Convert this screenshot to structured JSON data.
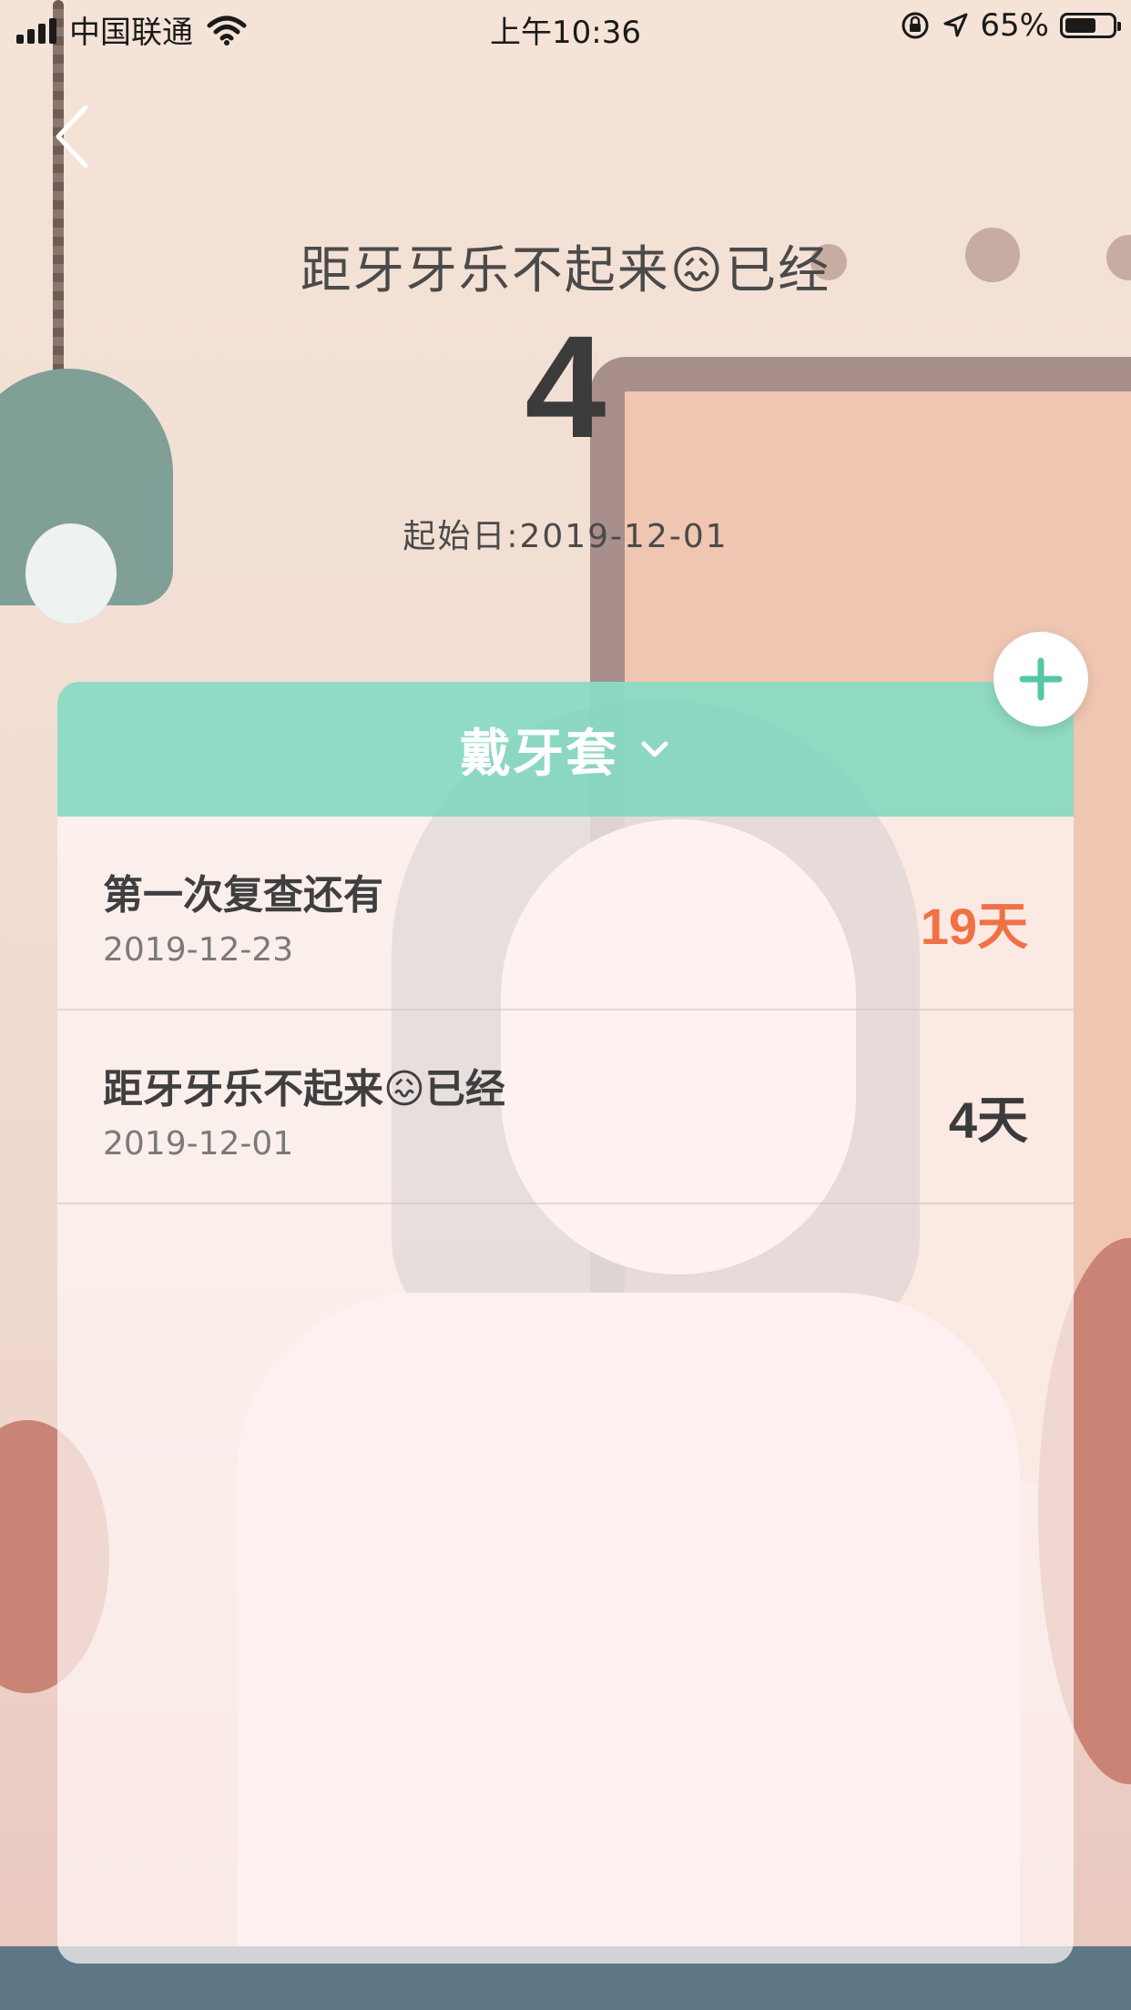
{
  "status_bar": {
    "carrier": "中国联通",
    "time": "上午10:36",
    "battery_percent": "65%",
    "battery_level": 0.65
  },
  "header": {
    "title": "距牙牙乐不起来😖已经",
    "days": "4",
    "start_date": "起始日:2019-12-01"
  },
  "card": {
    "category": "戴牙套",
    "items": [
      {
        "title": "第一次复查还有",
        "date": "2019-12-23",
        "count": "19天",
        "count_color": "#ef7245"
      },
      {
        "title": "距牙牙乐不起来😖已经",
        "date": "2019-12-01",
        "count": "4天",
        "count_color": "#3b3b3b"
      }
    ]
  },
  "icons": {
    "back": "chevron-left-icon",
    "add": "plus-icon",
    "dropdown": "chevron-down-icon"
  },
  "colors": {
    "accent": "#78d6bc",
    "countdown": "#ef7245"
  }
}
